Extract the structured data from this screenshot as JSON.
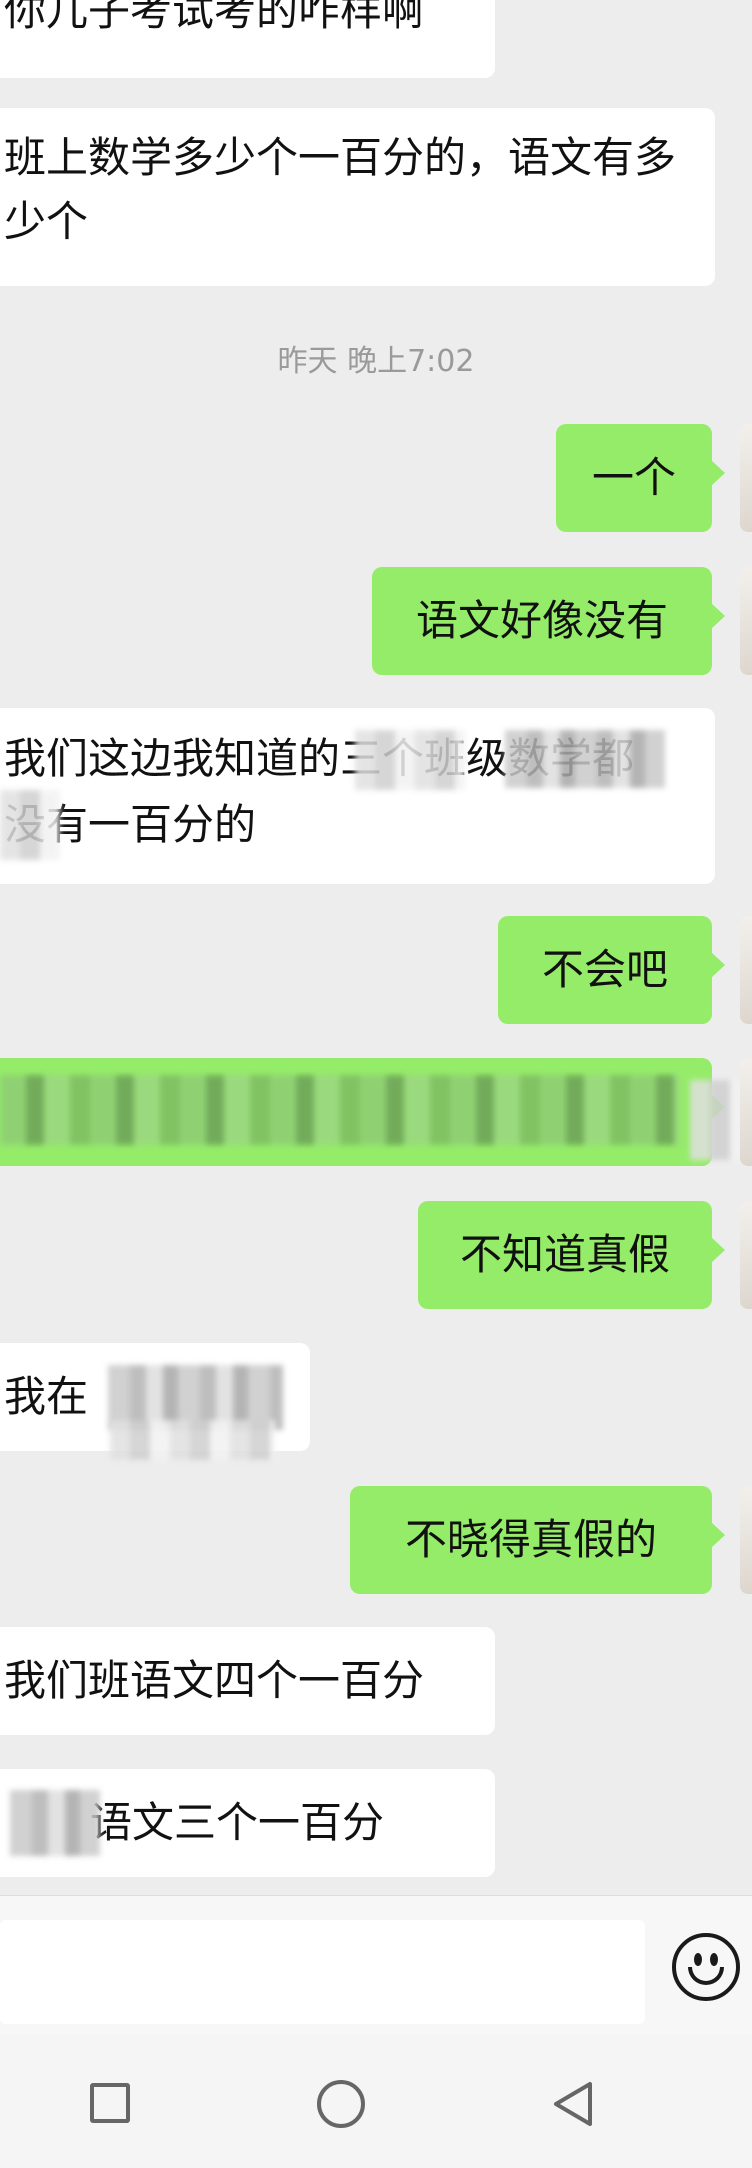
{
  "messages": {
    "m1": "你儿子考试考的咋样啊",
    "m2": "班上数学多少个一百分的，语文有多少个",
    "time": "昨天 晚上7:02",
    "m3": "一个",
    "m4": "语文好像没有",
    "m5": "我们这边我知道的三个班级数学都没有一百分的",
    "m6": "不会吧",
    "m7": "不知道真假",
    "m8": "我在",
    "m9": "不晓得真假的",
    "m10": "我们班语文四个一百分",
    "m11": "语文三个一百分"
  },
  "input": {
    "placeholder": ""
  },
  "icons": [
    "emoji-icon",
    "recent-apps-icon",
    "home-icon",
    "back-icon"
  ],
  "colors": {
    "background": "#ededed",
    "sent_bubble": "#95ec69",
    "received_bubble": "#ffffff"
  }
}
